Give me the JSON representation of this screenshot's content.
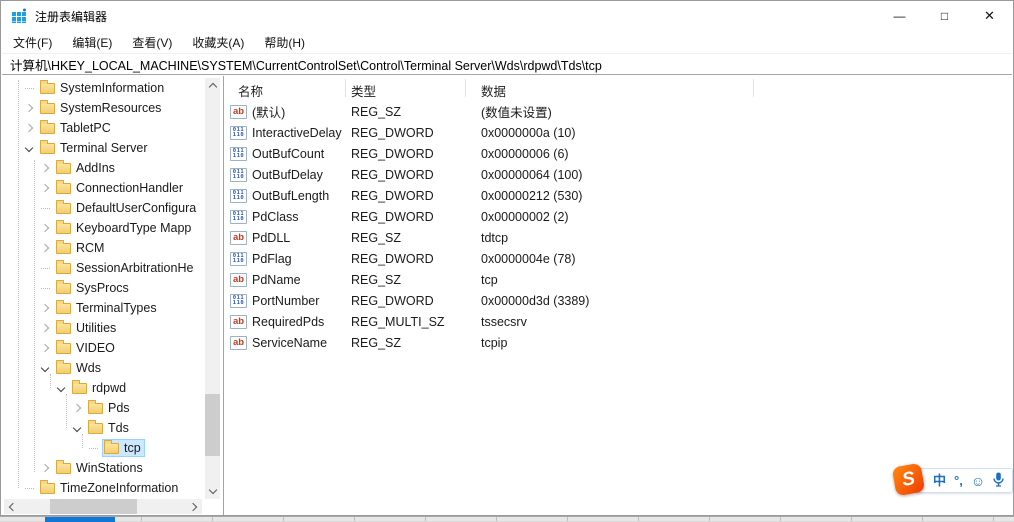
{
  "window": {
    "title": "注册表编辑器"
  },
  "titlebar": {
    "minimize_glyph": "—",
    "maximize_glyph": "□",
    "close_glyph": "✕"
  },
  "menu": {
    "items": [
      {
        "label": "文件(F)"
      },
      {
        "label": "编辑(E)"
      },
      {
        "label": "查看(V)"
      },
      {
        "label": "收藏夹(A)"
      },
      {
        "label": "帮助(H)"
      }
    ]
  },
  "address_bar": {
    "path": "计算机\\HKEY_LOCAL_MACHINE\\SYSTEM\\CurrentControlSet\\Control\\Terminal Server\\Wds\\rdpwd\\Tds\\tcp"
  },
  "tree": {
    "items": [
      {
        "label": "SystemInformation",
        "level": 1,
        "expander": "none"
      },
      {
        "label": "SystemResources",
        "level": 1,
        "expander": "collapsed"
      },
      {
        "label": "TabletPC",
        "level": 1,
        "expander": "collapsed"
      },
      {
        "label": "Terminal Server",
        "level": 1,
        "expander": "expanded"
      },
      {
        "label": "AddIns",
        "level": 2,
        "expander": "collapsed"
      },
      {
        "label": "ConnectionHandler",
        "level": 2,
        "expander": "collapsed"
      },
      {
        "label": "DefaultUserConfigura",
        "level": 2,
        "expander": "none"
      },
      {
        "label": "KeyboardType Mapp",
        "level": 2,
        "expander": "collapsed"
      },
      {
        "label": "RCM",
        "level": 2,
        "expander": "collapsed"
      },
      {
        "label": "SessionArbitrationHe",
        "level": 2,
        "expander": "none"
      },
      {
        "label": "SysProcs",
        "level": 2,
        "expander": "none"
      },
      {
        "label": "TerminalTypes",
        "level": 2,
        "expander": "collapsed"
      },
      {
        "label": "Utilities",
        "level": 2,
        "expander": "collapsed"
      },
      {
        "label": "VIDEO",
        "level": 2,
        "expander": "collapsed"
      },
      {
        "label": "Wds",
        "level": 2,
        "expander": "expanded"
      },
      {
        "label": "rdpwd",
        "level": 3,
        "expander": "expanded"
      },
      {
        "label": "Pds",
        "level": 4,
        "expander": "collapsed"
      },
      {
        "label": "Tds",
        "level": 4,
        "expander": "expanded"
      },
      {
        "label": "tcp",
        "level": 5,
        "expander": "none",
        "selected": true
      },
      {
        "label": "WinStations",
        "level": 2,
        "expander": "collapsed"
      },
      {
        "label": "TimeZoneInformation",
        "level": 1,
        "expander": "none"
      }
    ]
  },
  "list": {
    "columns": [
      {
        "label": "名称"
      },
      {
        "label": "类型"
      },
      {
        "label": "数据"
      }
    ],
    "rows": [
      {
        "icon": "string-value-icon",
        "name": "(默认)",
        "type": "REG_SZ",
        "data": "(数值未设置)"
      },
      {
        "icon": "dword-value-icon",
        "name": "InteractiveDelay",
        "type": "REG_DWORD",
        "data": "0x0000000a (10)"
      },
      {
        "icon": "dword-value-icon",
        "name": "OutBufCount",
        "type": "REG_DWORD",
        "data": "0x00000006 (6)"
      },
      {
        "icon": "dword-value-icon",
        "name": "OutBufDelay",
        "type": "REG_DWORD",
        "data": "0x00000064 (100)"
      },
      {
        "icon": "dword-value-icon",
        "name": "OutBufLength",
        "type": "REG_DWORD",
        "data": "0x00000212 (530)"
      },
      {
        "icon": "dword-value-icon",
        "name": "PdClass",
        "type": "REG_DWORD",
        "data": "0x00000002 (2)"
      },
      {
        "icon": "string-value-icon",
        "name": "PdDLL",
        "type": "REG_SZ",
        "data": "tdtcp"
      },
      {
        "icon": "dword-value-icon",
        "name": "PdFlag",
        "type": "REG_DWORD",
        "data": "0x0000004e (78)"
      },
      {
        "icon": "string-value-icon",
        "name": "PdName",
        "type": "REG_SZ",
        "data": "tcp"
      },
      {
        "icon": "dword-value-icon",
        "name": "PortNumber",
        "type": "REG_DWORD",
        "data": "0x00000d3d (3389)"
      },
      {
        "icon": "string-value-icon",
        "name": "RequiredPds",
        "type": "REG_MULTI_SZ",
        "data": "tssecsrv"
      },
      {
        "icon": "string-value-icon",
        "name": "ServiceName",
        "type": "REG_SZ",
        "data": "tcpip"
      }
    ]
  },
  "icons": {
    "string_value_glyph": "ab",
    "dword_value_glyph_top": "011",
    "dword_value_glyph_bottom": "110"
  },
  "ime": {
    "logo_glyph": "S",
    "lang_mode": "中",
    "punctuation": "°,",
    "emoji_glyph": "☺"
  },
  "colors": {
    "selection_bg": "#cce8ff",
    "selection_border": "#99d1ff",
    "folder_yellow": "#f3cd70",
    "ime_blue": "#1b6ec2",
    "sogou_orange": "#f03c00",
    "taskbar_blue": "#1177d7"
  }
}
